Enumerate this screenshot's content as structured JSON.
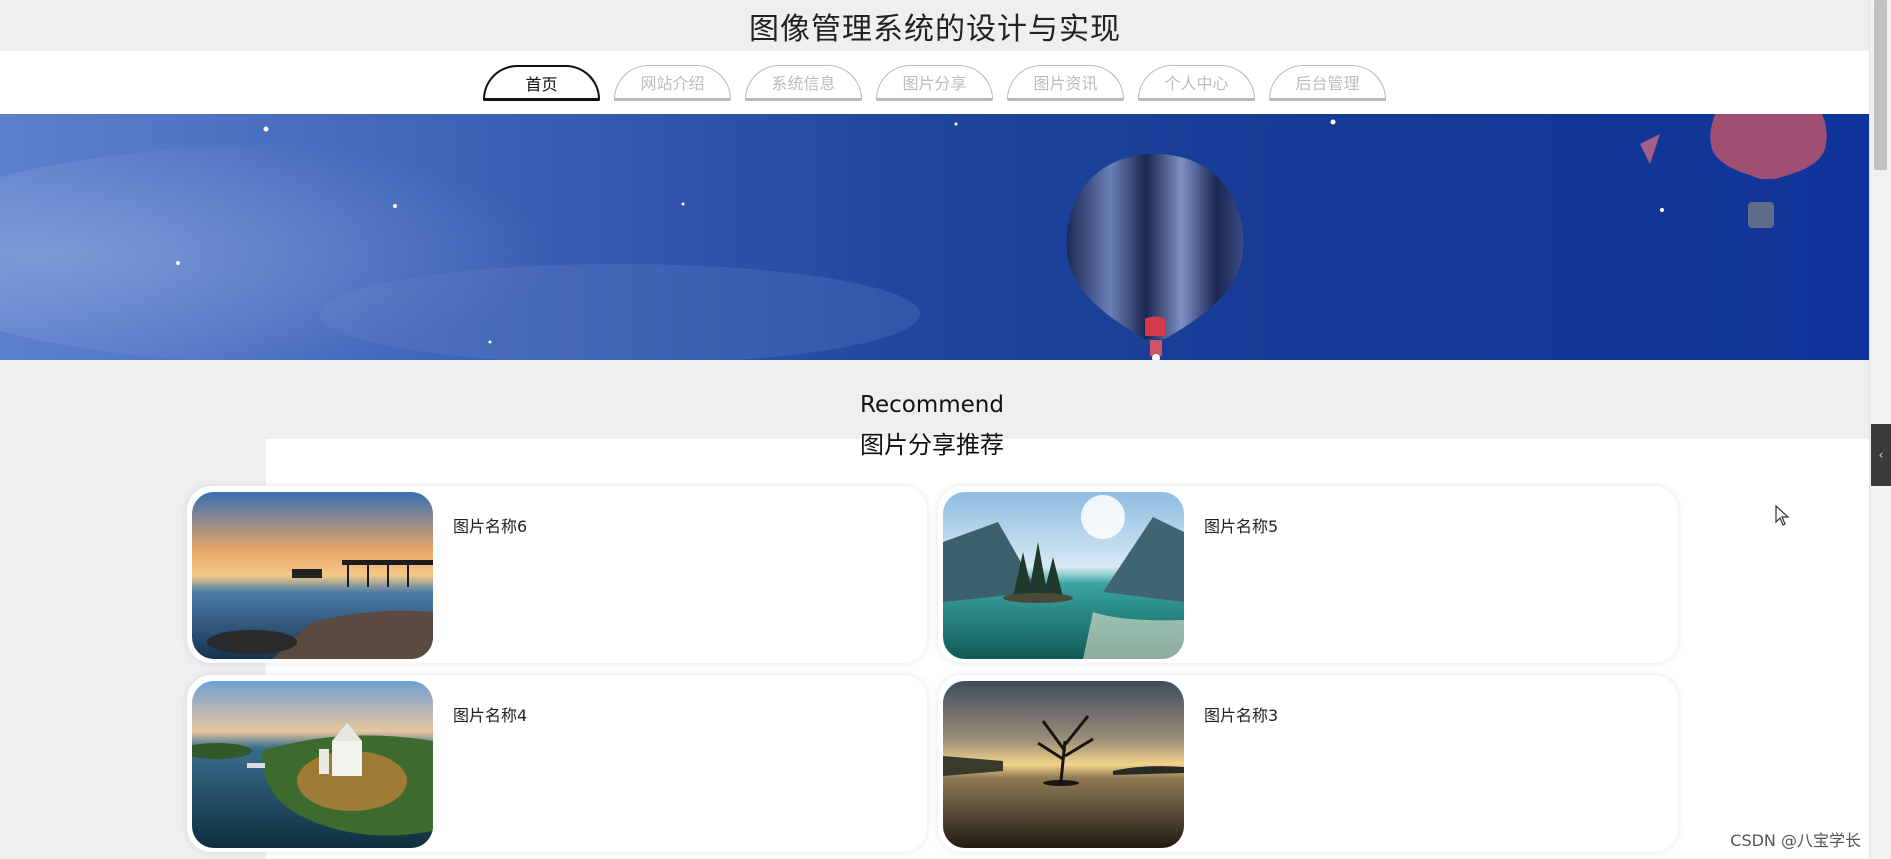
{
  "site": {
    "title": "图像管理系统的设计与实现"
  },
  "nav": [
    {
      "label": "首页",
      "active": true
    },
    {
      "label": "网站介绍",
      "active": false
    },
    {
      "label": "系统信息",
      "active": false
    },
    {
      "label": "图片分享",
      "active": false
    },
    {
      "label": "图片资讯",
      "active": false
    },
    {
      "label": "个人中心",
      "active": false
    },
    {
      "label": "后台管理",
      "active": false
    }
  ],
  "section": {
    "title_en": "Recommend",
    "title_cn": "图片分享推荐"
  },
  "cards": [
    {
      "name": "图片名称6"
    },
    {
      "name": "图片名称5"
    },
    {
      "name": "图片名称4"
    },
    {
      "name": "图片名称3"
    }
  ],
  "side_tab": {
    "glyph": "‹"
  },
  "watermark": "CSDN @八宝学长"
}
